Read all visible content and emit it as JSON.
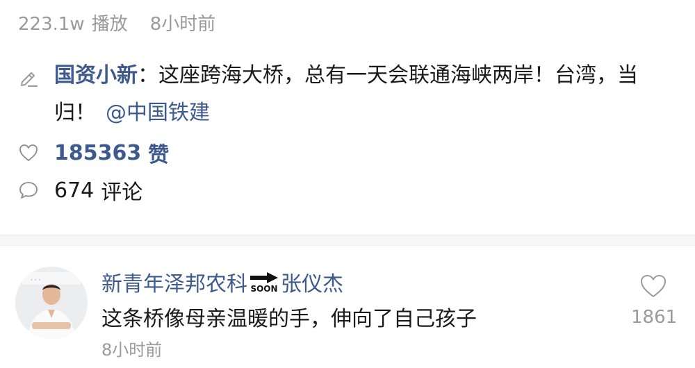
{
  "meta": {
    "views": "223.1w",
    "views_label": "播放",
    "time": "8小时前"
  },
  "post": {
    "edit_icon": "pencil-icon",
    "author": "国资小新",
    "colon": "：",
    "text": "这座跨海大桥，总有一天会联通海峡两岸！台湾，当归！",
    "mention": "@中国铁建"
  },
  "likes": {
    "icon": "heart-icon",
    "count": "185363",
    "label": "赞"
  },
  "comments_stat": {
    "icon": "comment-bubble-icon",
    "count": "674",
    "label": "评论"
  },
  "comment": {
    "avatar": "avatar",
    "name_part1": "新青年泽邦农科",
    "badge_text": "SOON",
    "name_part2": "张仪杰",
    "text": "这条桥像母亲温暖的手，伸向了自己孩子",
    "time": "8小时前",
    "like_icon": "heart-icon",
    "like_count": "1861"
  },
  "colors": {
    "link_blue": "#3d5a8f",
    "muted_gray": "#9a9a9a",
    "text": "#1a1a1a"
  }
}
